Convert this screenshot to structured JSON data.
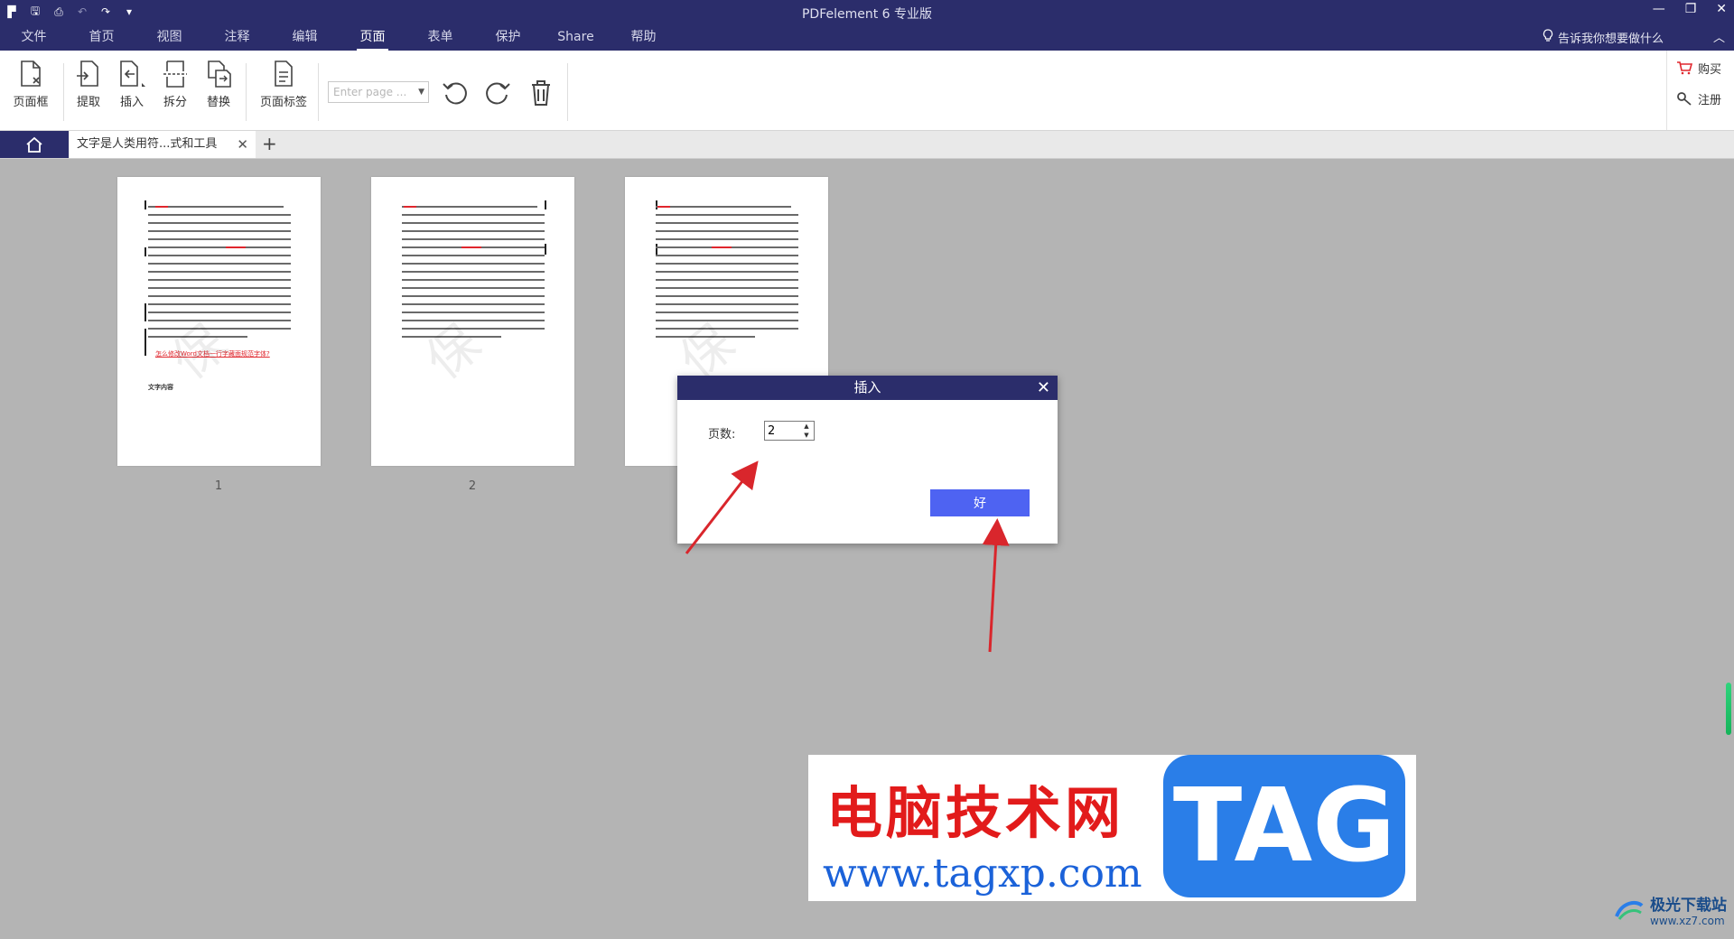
{
  "window": {
    "title": "PDFelement  6 专业版"
  },
  "menu": {
    "items": [
      "文件",
      "首页",
      "视图",
      "注释",
      "编辑",
      "页面",
      "表单",
      "保护",
      "Share",
      "帮助"
    ],
    "active_index": 5,
    "tell_me": "告诉我你想要做什么"
  },
  "ribbon": {
    "page_box": "页面框",
    "extract": "提取",
    "insert": "插入",
    "split": "拆分",
    "replace": "替换",
    "page_label": "页面标签",
    "page_input_placeholder": "Enter page ...",
    "buy": "购买",
    "register": "注册"
  },
  "tabs": {
    "document_title": "文字是人类用符...式和工具"
  },
  "thumbnails": {
    "page_numbers": [
      "1",
      "2"
    ],
    "watermark": "保",
    "link_text": "怎么修改Word文档一行字藏面规范字体?",
    "subheading": "文字内容"
  },
  "dialog": {
    "title": "插入",
    "page_count_label": "页数:",
    "page_count_value": "2",
    "ok_label": "好"
  },
  "overlay": {
    "site_name": "电脑技术网",
    "site_url": "www.tagxp.com",
    "tag_text": "TAG",
    "corner_brand": "极光下载站",
    "corner_url": "www.xz7.com"
  },
  "colors": {
    "titlebar": "#2b2d6b",
    "ok_button": "#4e63f2",
    "annotation_arrow": "#d9262c"
  }
}
